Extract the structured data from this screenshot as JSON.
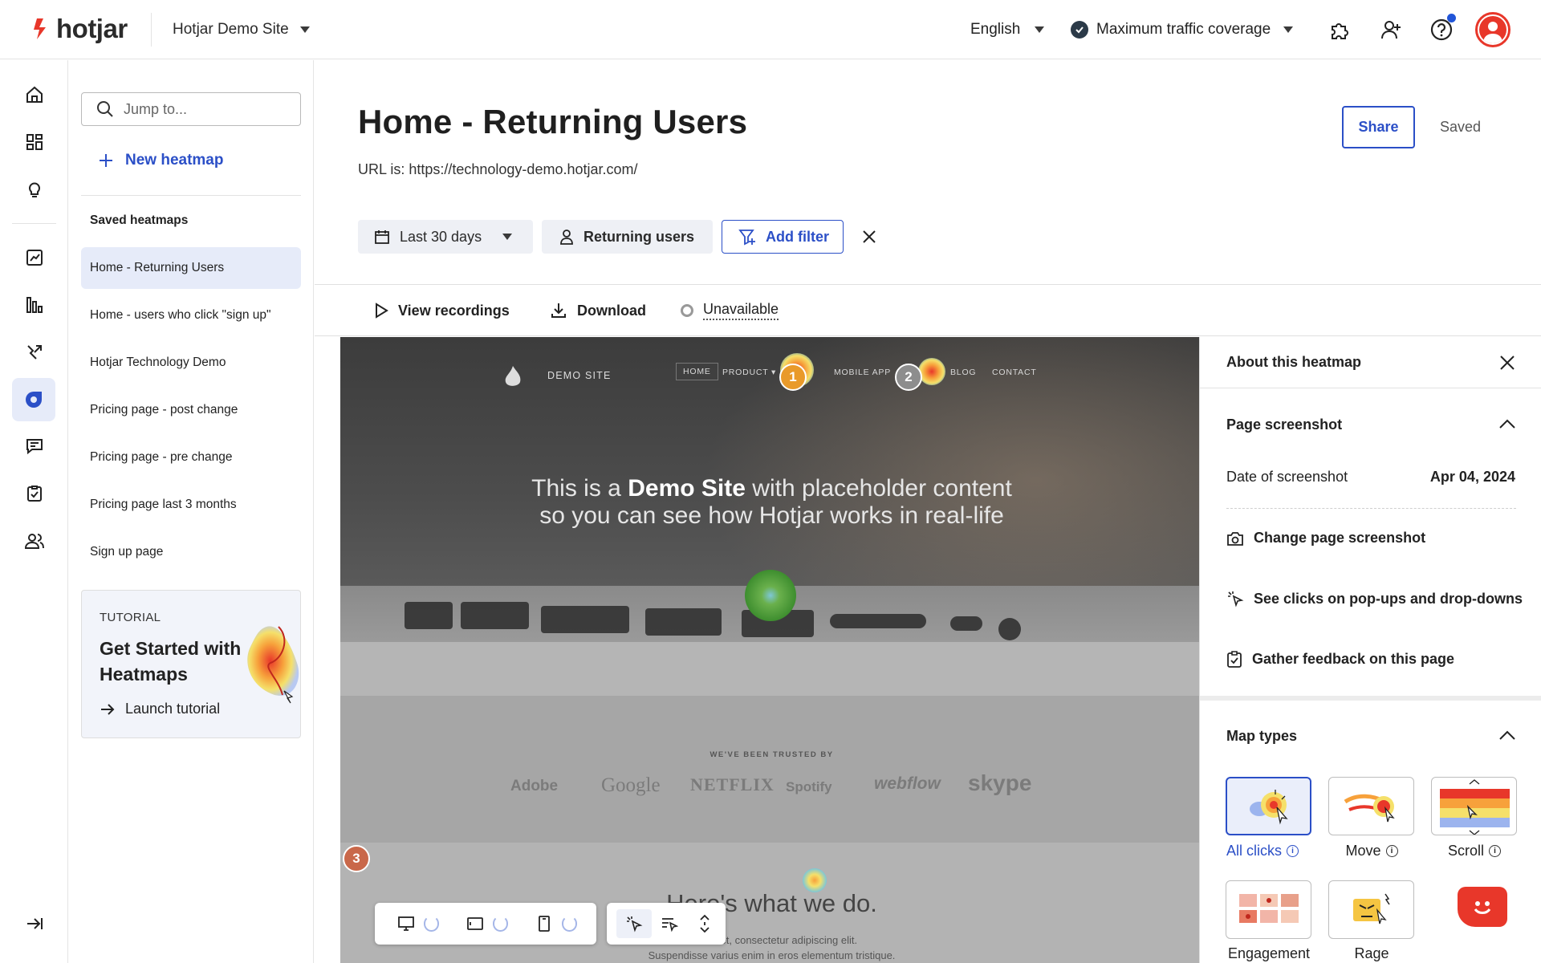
{
  "app": {
    "logo_text": "hotjar",
    "site_selector": "Hotjar Demo Site",
    "language": "English",
    "traffic": "Maximum traffic coverage",
    "colors": {
      "brand": "#e8372a",
      "accent": "#2b4fc7",
      "selected_bg": "#e6ebf9"
    }
  },
  "rail": {
    "icons": [
      "home-icon",
      "dashboard-icon",
      "lightbulb-icon",
      "trends-icon",
      "funnels-icon",
      "journeys-icon",
      "heatmaps-icon",
      "feedback-icon",
      "surveys-icon",
      "interviews-icon",
      "collapse-icon"
    ]
  },
  "sidebar": {
    "search_placeholder": "Jump to...",
    "new_heatmap": "New heatmap",
    "saved_title": "Saved heatmaps",
    "items": [
      {
        "label": "Home - Returning Users",
        "selected": true
      },
      {
        "label": "Home - users who click \"sign up\""
      },
      {
        "label": "Hotjar Technology Demo"
      },
      {
        "label": "Pricing page - post change"
      },
      {
        "label": "Pricing page - pre change"
      },
      {
        "label": "Pricing page last 3 months"
      },
      {
        "label": "Sign up page"
      }
    ],
    "tutorial": {
      "kicker": "TUTORIAL",
      "title": "Get Started with Heatmaps",
      "link": "Launch tutorial"
    }
  },
  "header": {
    "title": "Home - Returning Users",
    "url": "URL is: https://technology-demo.hotjar.com/",
    "share": "Share",
    "saved": "Saved"
  },
  "filters": {
    "date": "Last 30 days",
    "segment": "Returning users",
    "add_filter": "Add filter"
  },
  "actions": {
    "view_recordings": "View recordings",
    "download": "Download",
    "status": "Unavailable"
  },
  "screenshot": {
    "nav": {
      "site": "DEMO SITE",
      "links": [
        "HOME",
        "PRODUCT ▾",
        "MOBILE APP",
        "BLOG",
        "CONTACT"
      ]
    },
    "hero_pre": "This is a",
    "hero_bold": "Demo Site",
    "hero_post": "with placeholder content",
    "hero_line2": "so you can see how Hotjar works in real-life",
    "trusted": "WE'VE BEEN TRUSTED BY",
    "brands": [
      "Adobe",
      "Google",
      "NETFLIX",
      "Spotify",
      "webflow",
      "skype"
    ],
    "section_heading": "Here's what we do.",
    "section_text_1": "r sit amet, consectetur adipiscing elit.",
    "section_text_2": "Suspendisse varius enim in eros elementum tristique.",
    "markers": [
      "1",
      "2",
      "3"
    ]
  },
  "panel": {
    "title": "About this heatmap",
    "page_screenshot": "Page screenshot",
    "date_label": "Date of screenshot",
    "date_value": "Apr 04, 2024",
    "change_screenshot": "Change page screenshot",
    "popups": "See clicks on pop-ups and drop-downs",
    "feedback": "Gather feedback on this page",
    "map_types": "Map types",
    "types": [
      {
        "label": "All clicks",
        "selected": true
      },
      {
        "label": "Move"
      },
      {
        "label": "Scroll"
      },
      {
        "label": "Engagement"
      },
      {
        "label": "Rage"
      }
    ]
  }
}
